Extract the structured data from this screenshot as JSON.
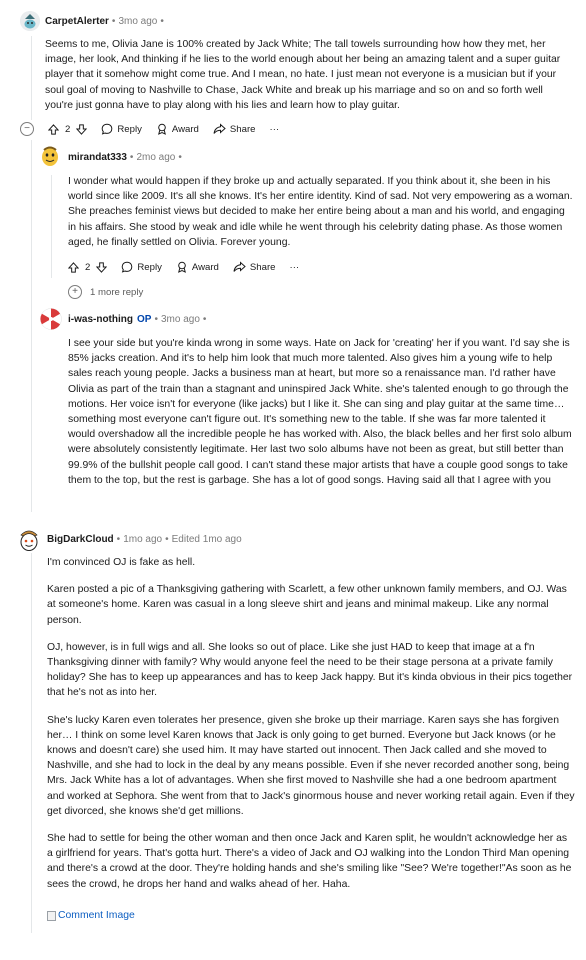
{
  "comments": [
    {
      "username": "CarpetAlerter",
      "time": "3mo ago",
      "body": "Seems to me, Olivia Jane is 100% created by Jack White; The tall towels surrounding how how they met, her image, her look, And thinking if he lies to the world enough about her being an amazing talent and a super guitar player that it somehow might come true. And I mean, no hate. I just mean not everyone is a musician but if your soul goal of moving to Nashville to Chase, Jack White and break up his marriage and so on and so forth well you're just gonna have to play along with his lies and learn how to play guitar.",
      "votes": "2",
      "reply": "Reply",
      "award": "Award",
      "share": "Share",
      "more": "···"
    },
    {
      "username": "mirandat333",
      "time": "2mo ago",
      "body": "I wonder what would happen if they broke up and actually separated. If you think about it, she been in his world since like 2009. It's all she knows. It's her entire identity. Kind of sad. Not very empowering as a woman. She preaches feminist views but decided to make her entire being about a man and his world, and engaging in his affairs. She stood by weak and idle while he went through his celebrity dating phase. As those women aged, he finally settled on Olivia. Forever young.",
      "votes": "2",
      "reply": "Reply",
      "award": "Award",
      "share": "Share",
      "more": "···",
      "more_replies": "1 more reply"
    },
    {
      "username": "i-was-nothing",
      "op": "OP",
      "time": "3mo ago",
      "body": "I see your side but you're kinda wrong in some ways. Hate on Jack for 'creating' her if you want. I'd say she is 85% jacks creation. And it's to help him look that much more talented. Also gives him a young wife to help sales reach young people. Jacks a business man at heart, but more so a renaissance man. I'd rather have Olivia as part of the train than a stagnant and uninspired Jack White. she's talented enough to go through the motions. Her voice isn't for everyone (like jacks) but I like it. She can sing and play guitar at the same time… something most everyone can't figure out. It's something new to the table. If she was far more talented it would overshadow all the incredible people he has worked with. Also, the black belles and her first solo album were absolutely consistently legitimate. Her last two solo albums have not been as great, but still better than 99.9% of the bullshit people call good. I can't stand these major artists that have a couple good songs to take them to the top, but the rest is garbage. She has a lot of good songs. Having said all that I agree with you"
    },
    {
      "username": "BigDarkCloud",
      "time": "1mo ago",
      "edited": "Edited 1mo ago",
      "paragraphs": [
        "I'm convinced OJ is fake as hell.",
        "Karen posted a pic of a Thanksgiving gathering with Scarlett, a few other unknown family members, and OJ. Was at someone's home. Karen was casual in a long sleeve shirt and jeans and minimal makeup. Like any normal person.",
        "OJ, however, is in full wigs and all. She looks so out of place. Like she just HAD to keep that image at a f'n Thanksgiving dinner with family? Why would anyone feel the need to be their stage persona at a private family holiday? She has to keep up appearances and has to keep Jack happy. But it's kinda obvious in their pics together that he's not as into her.",
        "She's lucky Karen even tolerates her presence, given she broke up their marriage. Karen says she has forgiven her… I think on some level Karen knows that Jack is only going to get burned. Everyone but Jack knows (or he knows and doesn't care) she used him. It may have started out innocent. Then Jack called and she moved to Nashville, and she had to lock in the deal by any means possible. Even if she never recorded another song, being Mrs. Jack White has a lot of advantages. When she first moved to Nashville she had a one bedroom apartment and worked at Sephora. She went from that to Jack's ginormous house and never working retail again. Even if they get divorced, she knows she'd get millions.",
        "She had to settle for being the other woman and then once Jack and Karen split, he wouldn't acknowledge her as a girlfriend for years. That's gotta hurt. There's a video of Jack and OJ walking into the London Third Man opening and there's a crowd at the door. They're holding hands and she's smiling like \"See? We're together!\"As soon as he sees the crowd, he drops her hand and walks ahead of her. Haha."
      ],
      "image_alt": "Comment Image"
    }
  ],
  "icons": {
    "collapse": "collapse-minus-icon",
    "upvote": "upvote-arrow-icon",
    "downvote": "downvote-arrow-icon",
    "reply": "reply-bubble-icon",
    "award": "award-icon",
    "share": "share-arrow-icon",
    "expand": "expand-plus-icon"
  },
  "colors": {
    "text": "#1c1c1c",
    "meta": "#7c7c7c",
    "op": "#0045ac",
    "link": "#0e5fc2",
    "thread_line": "#e4e7e9"
  }
}
